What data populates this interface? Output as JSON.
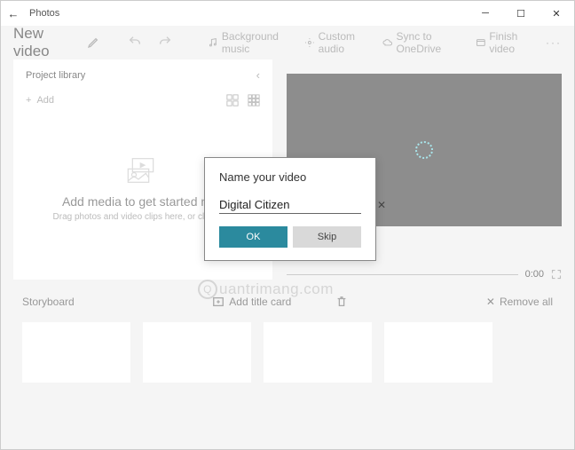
{
  "titlebar": {
    "app_name": "Photos"
  },
  "toolbar": {
    "video_name": "New video",
    "bg_music": "Background music",
    "custom_audio": "Custom audio",
    "sync": "Sync to OneDrive",
    "finish": "Finish video"
  },
  "library": {
    "heading": "Project library",
    "add_label": "Add",
    "empty_title": "Add media to get started now",
    "empty_sub": "Drag photos and video clips here, or click Add"
  },
  "preview": {
    "time": "0:00"
  },
  "storyboard": {
    "heading": "Storyboard",
    "add_title": "Add title card",
    "remove_all": "Remove all"
  },
  "dialog": {
    "title": "Name your video",
    "value": "Digital Citizen",
    "ok": "OK",
    "skip": "Skip"
  },
  "watermark": "uantrimang.com"
}
